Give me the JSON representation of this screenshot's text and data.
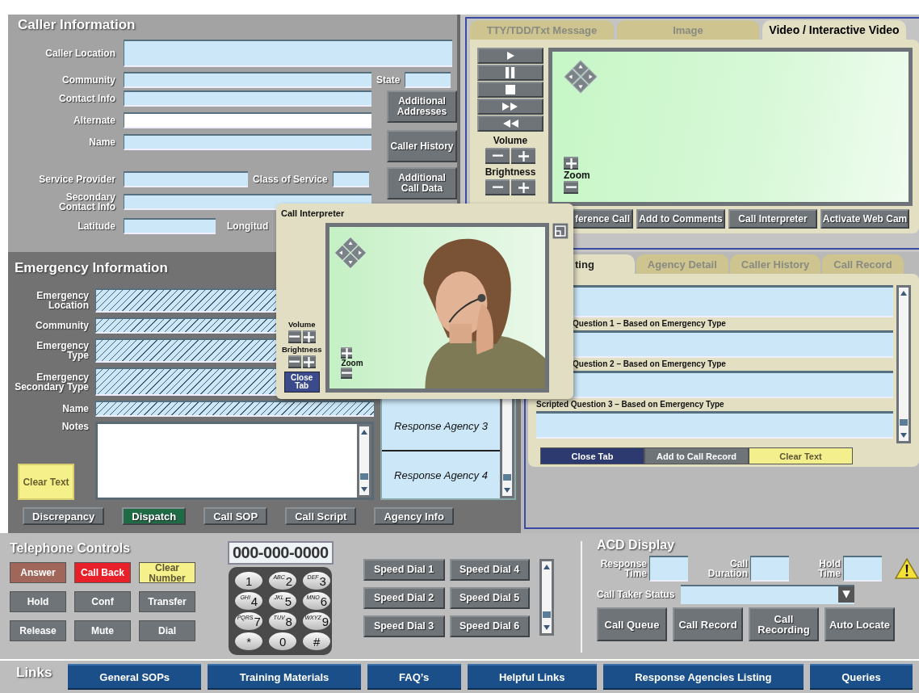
{
  "caller_info": {
    "title": "Caller Information",
    "caller_location": "Caller Location",
    "community": "Community",
    "state": "State",
    "contact_info": "Contact Info",
    "alternate": "Alternate",
    "name": "Name",
    "service_provider": "Service Provider",
    "class_of_service": "Class of Service",
    "secondary_contact_info": "Secondary Contact Info",
    "latitude": "Latitude",
    "longitude": "Longitud",
    "buttons": [
      "Additional Addresses",
      "Caller History",
      "Additional Call Data"
    ]
  },
  "media": {
    "tabs": [
      {
        "label": "TTY/TDD/Txt Message",
        "selected": false
      },
      {
        "label": "Image",
        "selected": false
      },
      {
        "label": "Video / Interactive Video",
        "selected": true
      }
    ],
    "volume": "Volume",
    "brightness": "Brightness",
    "zoom": "Zoom",
    "actions": [
      "ference Call",
      "Add to Comments",
      "Call Interpreter",
      "Activate Web Cam"
    ]
  },
  "emergency_info": {
    "title": "Emergency Information",
    "fields": [
      "Emergency Location",
      "Community",
      "Emergency Type",
      "Emergency Secondary Type",
      "Name"
    ],
    "notes": "Notes",
    "clear_text": "Clear Text",
    "agencies": [
      "Response Agency 3",
      "Response Agency 4"
    ],
    "buttons": [
      {
        "label": "Discrepancy",
        "color": "#6e7478"
      },
      {
        "label": "Dispatch",
        "color": "#1e6b45"
      },
      {
        "label": "Call SOP",
        "color": "#6e7478"
      },
      {
        "label": "Call Script",
        "color": "#6e7478"
      },
      {
        "label": "Agency Info",
        "color": "#6e7478"
      }
    ]
  },
  "scripting": {
    "tabs": [
      {
        "label": "ting",
        "selected": true
      },
      {
        "label": "Agency Detail",
        "selected": false
      },
      {
        "label": "Caller History",
        "selected": false
      },
      {
        "label": "Call Record",
        "selected": false
      }
    ],
    "questions": [
      "Question 1 – Based on Emergency Type",
      "Question 2 – Based on Emergency Type",
      "Scripted Question 3 – Based on Emergency Type"
    ],
    "buttons": [
      {
        "label": "Close Tab",
        "color": "#2c3a70"
      },
      {
        "label": "Add to Call Record",
        "color": "#6e7478"
      },
      {
        "label": "Clear Text",
        "color": "#f3ef8c"
      }
    ]
  },
  "popup": {
    "title": "Call Interpreter",
    "volume": "Volume",
    "brightness": "Brightness",
    "zoom": "Zoom",
    "close": "Close Tab"
  },
  "telephone": {
    "title": "Telephone Controls",
    "number": "000-000-0000",
    "buttons": [
      {
        "label": "Answer",
        "color": "#a0665a"
      },
      {
        "label": "Call Back",
        "color": "#e8202a"
      },
      {
        "label": "Clear Number",
        "color": "#f5f08a"
      },
      {
        "label": "Hold",
        "color": "#6e7478"
      },
      {
        "label": "Conf",
        "color": "#6e7478"
      },
      {
        "label": "Transfer",
        "color": "#6e7478"
      },
      {
        "label": "Release",
        "color": "#6e7478"
      },
      {
        "label": "Mute",
        "color": "#6e7478"
      },
      {
        "label": "Dial",
        "color": "#6e7478"
      }
    ],
    "keys": [
      {
        "digit": "1"
      },
      {
        "digit": "2",
        "letters": "ABC"
      },
      {
        "digit": "3",
        "letters": "DEF"
      },
      {
        "digit": "4",
        "letters": "GHI"
      },
      {
        "digit": "5",
        "letters": "JKL"
      },
      {
        "digit": "6",
        "letters": "MNO"
      },
      {
        "digit": "7",
        "letters": "PQRS"
      },
      {
        "digit": "8",
        "letters": "TUV"
      },
      {
        "digit": "9",
        "letters": "WXYZ"
      },
      {
        "digit": "*"
      },
      {
        "digit": "0"
      },
      {
        "digit": "#"
      }
    ],
    "speed_dials": [
      "Speed Dial 1",
      "Speed Dial 2",
      "Speed Dial 3",
      "Speed Dial 4",
      "Speed Dial 5",
      "Speed Dial 6"
    ]
  },
  "acd": {
    "title": "ACD Display",
    "fields": [
      "Response Time",
      "Call Duration",
      "Hold Time"
    ],
    "status_label": "Call Taker Status",
    "buttons": [
      "Call Queue",
      "Call Record",
      "Call Recording",
      "Auto Locate"
    ]
  },
  "links": {
    "title": "Links",
    "items": [
      "General SOPs",
      "Training Materials",
      "FAQ’s",
      "Helpful Links",
      "Response Agencies Listing",
      "Queries"
    ]
  }
}
